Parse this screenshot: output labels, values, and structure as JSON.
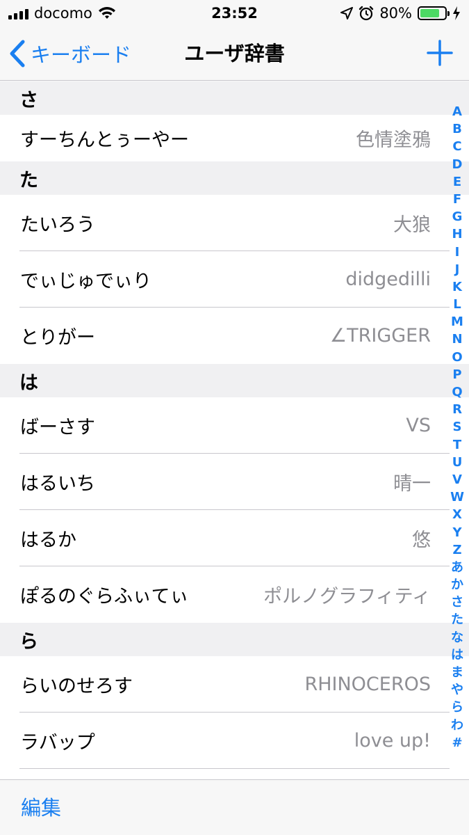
{
  "status_bar": {
    "carrier": "docomo",
    "time": "23:52",
    "battery": "80%",
    "battery_level": 0.8
  },
  "nav": {
    "back_label": "キーボード",
    "title": "ユーザ辞書"
  },
  "sections": [
    {
      "header": "さ",
      "entries": [
        {
          "reading": "すーちんとぅーやー",
          "word": "色情塗鴉"
        }
      ]
    },
    {
      "header": "た",
      "entries": [
        {
          "reading": "たいろう",
          "word": "大狼"
        },
        {
          "reading": "でぃじゅでぃり",
          "word": "didgedilli"
        },
        {
          "reading": "とりがー",
          "word": "∠TRIGGER"
        }
      ]
    },
    {
      "header": "は",
      "entries": [
        {
          "reading": "ばーさす",
          "word": "VS"
        },
        {
          "reading": "はるいち",
          "word": "晴一"
        },
        {
          "reading": "はるか",
          "word": "悠"
        },
        {
          "reading": "ぽるのぐらふぃてぃ",
          "word": "ポルノグラフィティ"
        }
      ]
    },
    {
      "header": "ら",
      "entries": [
        {
          "reading": "らいのせろす",
          "word": "RHINOCEROS"
        },
        {
          "reading": "ラバップ",
          "word": "love up!"
        }
      ]
    }
  ],
  "index": [
    "A",
    "B",
    "C",
    "D",
    "E",
    "F",
    "G",
    "H",
    "I",
    "J",
    "K",
    "L",
    "M",
    "N",
    "O",
    "P",
    "Q",
    "R",
    "S",
    "T",
    "U",
    "V",
    "W",
    "X",
    "Y",
    "Z",
    "あ",
    "か",
    "さ",
    "た",
    "な",
    "は",
    "ま",
    "や",
    "ら",
    "わ",
    "#"
  ],
  "toolbar": {
    "edit_label": "編集"
  },
  "colors": {
    "accent": "#1a7ff0",
    "secondary_text": "#8e8e93",
    "battery": "#4cd964"
  }
}
